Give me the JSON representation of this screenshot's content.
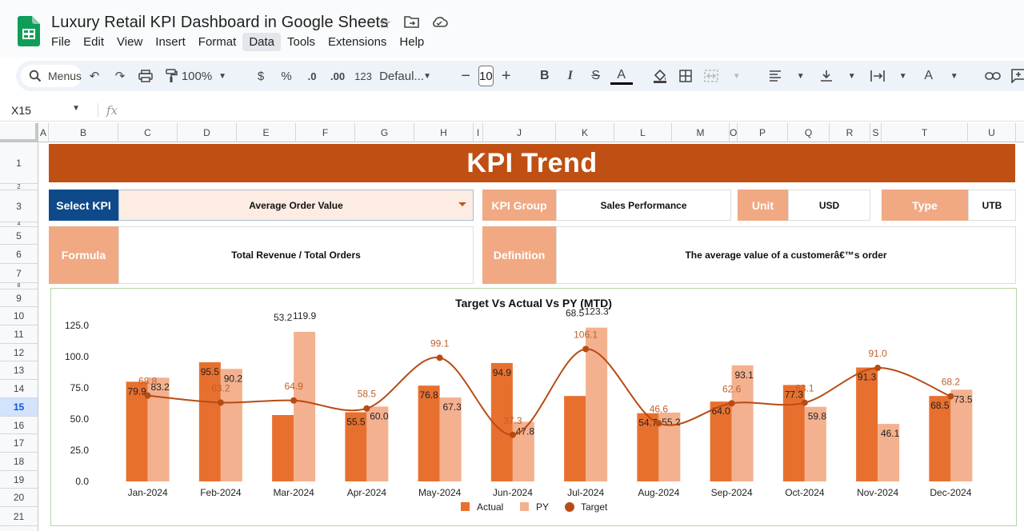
{
  "doc": {
    "title": "Luxury Retail KPI Dashboard in Google Sheets",
    "menu": [
      "File",
      "Edit",
      "View",
      "Insert",
      "Format",
      "Data",
      "Tools",
      "Extensions",
      "Help"
    ],
    "active_menu": "Data"
  },
  "toolbar": {
    "search_label": "Menus",
    "zoom": "100%",
    "currency": "$",
    "percent": "%",
    "dec_decrease": ".0",
    "dec_increase": ".00",
    "number_format": "123",
    "font": "Defaul...",
    "font_size": "10"
  },
  "formula_bar": {
    "cell_ref": "X15",
    "fx": "fx"
  },
  "grid": {
    "columns": [
      "A",
      "B",
      "C",
      "D",
      "E",
      "F",
      "G",
      "H",
      "I",
      "J",
      "K",
      "L",
      "M",
      "O",
      "P",
      "Q",
      "R",
      "S",
      "T",
      "U"
    ],
    "rows": [
      "1",
      "2",
      "3",
      "4",
      "5",
      "6",
      "7",
      "8",
      "9",
      "10",
      "11",
      "12",
      "13",
      "14",
      "15",
      "16",
      "17",
      "18",
      "19",
      "20",
      "21"
    ],
    "selected_row": "15"
  },
  "dashboard": {
    "banner": "KPI Trend",
    "select_kpi_label": "Select KPI",
    "select_kpi_value": "Average Order Value",
    "kpi_group_label": "KPI Group",
    "kpi_group_value": "Sales Performance",
    "unit_label": "Unit",
    "unit_value": "USD",
    "type_label": "Type",
    "type_value": "UTB",
    "formula_label": "Formula",
    "formula_value": "Total Revenue / Total Orders",
    "definition_label": "Definition",
    "definition_value": "The average value of a customerâ€™s order"
  },
  "colors": {
    "banner": "#bf4f12",
    "actual": "#e8702f",
    "py": "#f4b18f",
    "target": "#b84b14"
  },
  "chart_data": {
    "type": "bar",
    "title": "Target Vs Actual Vs PY (MTD)",
    "categories": [
      "Jan-2024",
      "Feb-2024",
      "Mar-2024",
      "Apr-2024",
      "May-2024",
      "Jun-2024",
      "Jul-2024",
      "Aug-2024",
      "Sep-2024",
      "Oct-2024",
      "Nov-2024",
      "Dec-2024"
    ],
    "series": [
      {
        "name": "Actual",
        "kind": "bar",
        "values": [
          79.9,
          95.5,
          53.2,
          55.5,
          76.8,
          94.9,
          68.5,
          54.7,
          64.0,
          77.3,
          91.3,
          68.5
        ]
      },
      {
        "name": "PY",
        "kind": "bar",
        "values": [
          83.2,
          90.2,
          119.9,
          60.0,
          67.3,
          47.8,
          123.3,
          55.2,
          93.1,
          59.8,
          46.1,
          73.5
        ]
      },
      {
        "name": "Target",
        "kind": "line",
        "values": [
          68.8,
          63.2,
          64.9,
          58.5,
          99.1,
          37.3,
          106.1,
          46.6,
          62.6,
          63.1,
          91.0,
          68.2
        ]
      }
    ],
    "yticks": [
      "0.0",
      "25.0",
      "50.0",
      "75.0",
      "100.0",
      "125.0"
    ],
    "ylim": [
      0,
      125
    ],
    "legend": "bottom"
  }
}
